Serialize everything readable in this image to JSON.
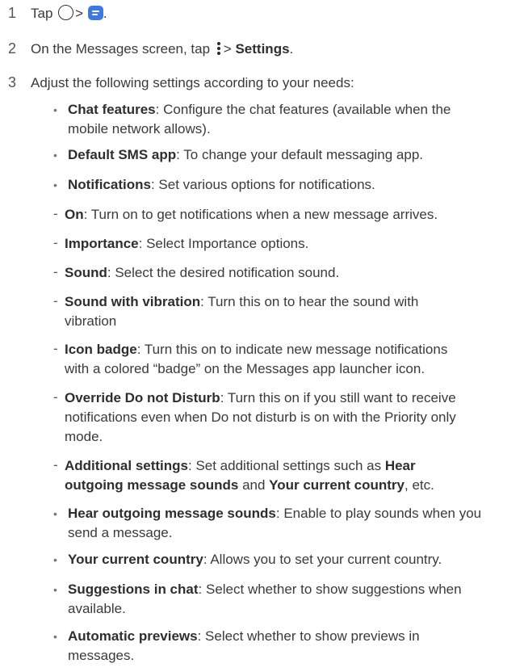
{
  "steps": {
    "s1": {
      "num": "1",
      "tap": "Tap",
      "gt": ">",
      "period": "."
    },
    "s2": {
      "num": "2",
      "pre": "On the Messages screen, tap",
      "gt": ">",
      "settings": "Settings",
      "period": "."
    },
    "s3": {
      "num": "3",
      "text": "Adjust the following settings according to your needs:"
    }
  },
  "items": {
    "chat": {
      "term": "Chat features",
      "desc1": ": Configure the chat features (available when the",
      "desc2": "mobile network allows)."
    },
    "sms": {
      "term": "Default SMS app",
      "desc": ": To change your default messaging app."
    },
    "notif": {
      "term": "Notifications",
      "desc": ": Set various options for notifications."
    },
    "on": {
      "term": "On",
      "desc": ": Turn on to get notifications when a new message arrives."
    },
    "importance": {
      "term": "Importance",
      "desc": ": Select Importance options."
    },
    "sound": {
      "term": "Sound",
      "desc": ": Select the desired notification sound."
    },
    "soundvib": {
      "term": "Sound with vibration",
      "desc1": ": Turn this on to hear the sound with",
      "desc2": "vibration"
    },
    "badge": {
      "term": "Icon badge",
      "desc1": ": Turn this on to indicate new message notifications",
      "desc2": "with a colored “badge” on the Messages app launcher icon."
    },
    "override": {
      "term": "Override Do not Disturb",
      "desc1": ": Turn this on if you still want to receive",
      "desc2": "notifications even when Do not disturb is on with the Priority only",
      "desc3": "mode."
    },
    "additional": {
      "term": "Additional settings",
      "desc1": ": Set additional settings such as ",
      "b1": "Hear",
      "b2": "outgoing message sounds",
      "and": " and ",
      "b3": "Your current country",
      "etc": ", etc."
    },
    "hear": {
      "term": "Hear outgoing message sounds",
      "desc1": ": Enable to play sounds when you",
      "desc2": "send a message."
    },
    "country": {
      "term": "Your current country",
      "desc": ": Allows you to set your current country."
    },
    "suggest": {
      "term": "Suggestions in chat",
      "desc1": ": Select whether to show suggestions when",
      "desc2": "available."
    },
    "previews": {
      "term": "Automatic previews",
      "desc1": ": Select whether to show previews in",
      "desc2": "messages."
    }
  },
  "marks": {
    "bullet": "•",
    "dash": "-"
  }
}
